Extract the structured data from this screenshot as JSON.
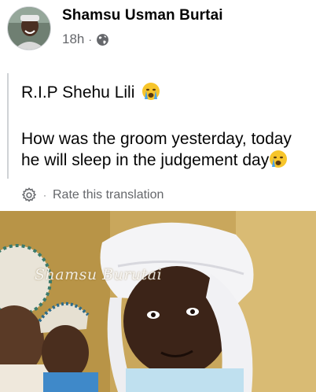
{
  "post": {
    "author": "Shamsu Usman Burtai",
    "time": "18h",
    "separator": "·",
    "privacy_icon": "globe-icon",
    "text_line_1": "R.I.P Shehu Lili",
    "text_line_2": "How was the groom yesterday, today",
    "text_line_3": "he will sleep in the judgement day",
    "emoji_icon": "crying-face-icon"
  },
  "translation": {
    "settings_icon": "gear-icon",
    "separator": "·",
    "rate_label": "Rate this translation"
  },
  "photo": {
    "watermark": "Shamsu Burutai"
  }
}
